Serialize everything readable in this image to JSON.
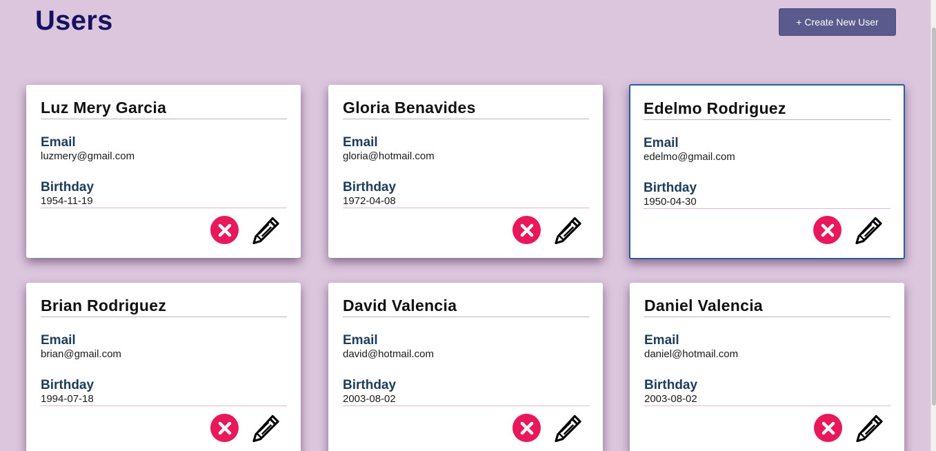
{
  "header": {
    "title": "Users",
    "create_button_label": "+ Create New User"
  },
  "labels": {
    "email": "Email",
    "birthday": "Birthday"
  },
  "users": [
    {
      "name": "Luz Mery Garcia",
      "email": "luzmery@gmail.com",
      "birthday": "1954-11-19"
    },
    {
      "name": "Gloria Benavides",
      "email": "gloria@hotmail.com",
      "birthday": "1972-04-08"
    },
    {
      "name": "Edelmo Rodriguez",
      "email": "edelmo@gmail.com",
      "birthday": "1950-04-30"
    },
    {
      "name": "Brian Rodriguez",
      "email": "brian@gmail.com",
      "birthday": "1994-07-18"
    },
    {
      "name": "David Valencia",
      "email": "david@hotmail.com",
      "birthday": "2003-08-02"
    },
    {
      "name": "Daniel Valencia",
      "email": "daniel@hotmail.com",
      "birthday": "2003-08-02"
    }
  ],
  "icons": {
    "delete": "close-circle-icon",
    "edit": "pencil-icon"
  },
  "colors": {
    "background": "#dcc6de",
    "title": "#16135e",
    "create_button": "#5a5a8c",
    "delete": "#e8185a",
    "label": "#1d3c5c",
    "focus_border": "#2a5d9c"
  }
}
